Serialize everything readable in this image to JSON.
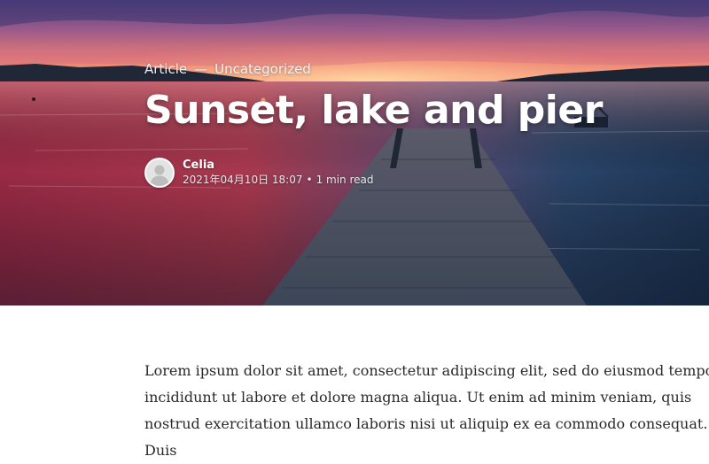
{
  "hero": {
    "category_label": "Article",
    "separator": "—",
    "category_name": "Uncategorized",
    "title": "Sunset, lake and pier",
    "author": "Celia",
    "date": "2021年04月10日 18:07",
    "meta_separator": "•",
    "read_time": "1 min read"
  },
  "content": {
    "paragraph": "Lorem ipsum dolor sit amet, consectetur adipiscing elit, sed do eiusmod tempor incididunt ut labore et dolore magna aliqua. Ut enim ad minim veniam, quis nostrud exercitation ullamco laboris nisi ut aliquip ex ea commodo consequat. Duis"
  },
  "icons": {
    "avatar": "user-avatar-icon"
  },
  "colors": {
    "sky_top": "#5a4a8a",
    "sunset_glow": "#f08a6a",
    "water_red": "#b8334a",
    "water_blue": "#1f3a5c",
    "pier": "#3b4658"
  }
}
